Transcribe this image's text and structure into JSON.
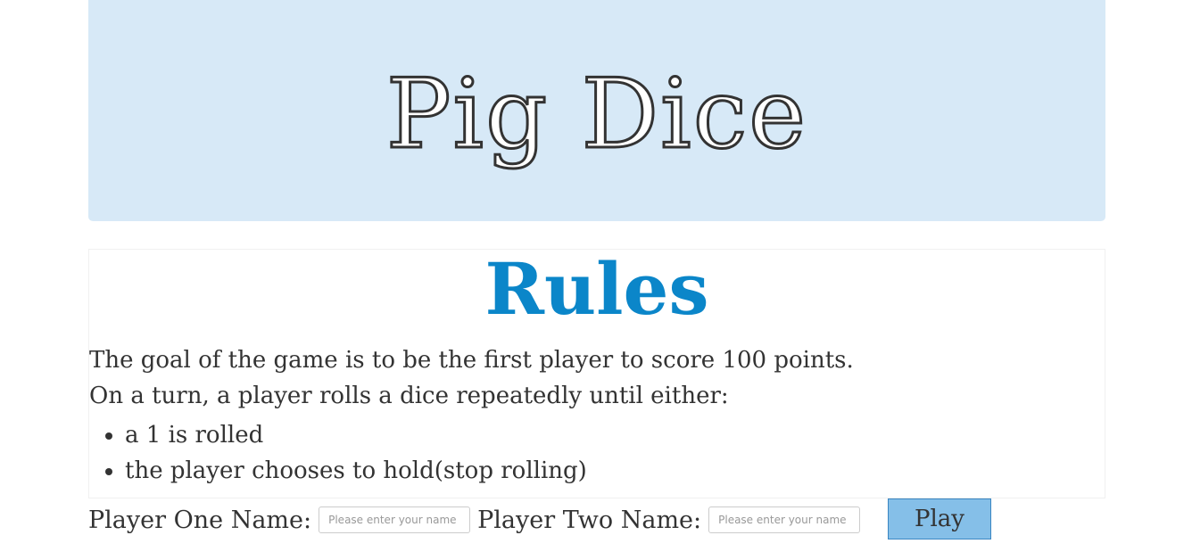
{
  "header": {
    "title": "Pig Dice"
  },
  "rules": {
    "title": "Rules",
    "lines": [
      "The goal of the game is to be the first player to score 100 points.",
      "On a turn, a player rolls a dice repeatedly until either:"
    ],
    "bullets": [
      "a 1 is rolled",
      "the player chooses to hold(stop rolling)"
    ]
  },
  "form": {
    "player_one_label": "Player One Name:",
    "player_one_placeholder": "Please enter your name",
    "player_two_label": "Player Two Name:",
    "player_two_placeholder": "Please enter your name",
    "play_label": "Play"
  },
  "colors": {
    "header_background": "#d7e9f7",
    "rules_title": "#0b86c9",
    "play_button": "#85bfe8"
  }
}
